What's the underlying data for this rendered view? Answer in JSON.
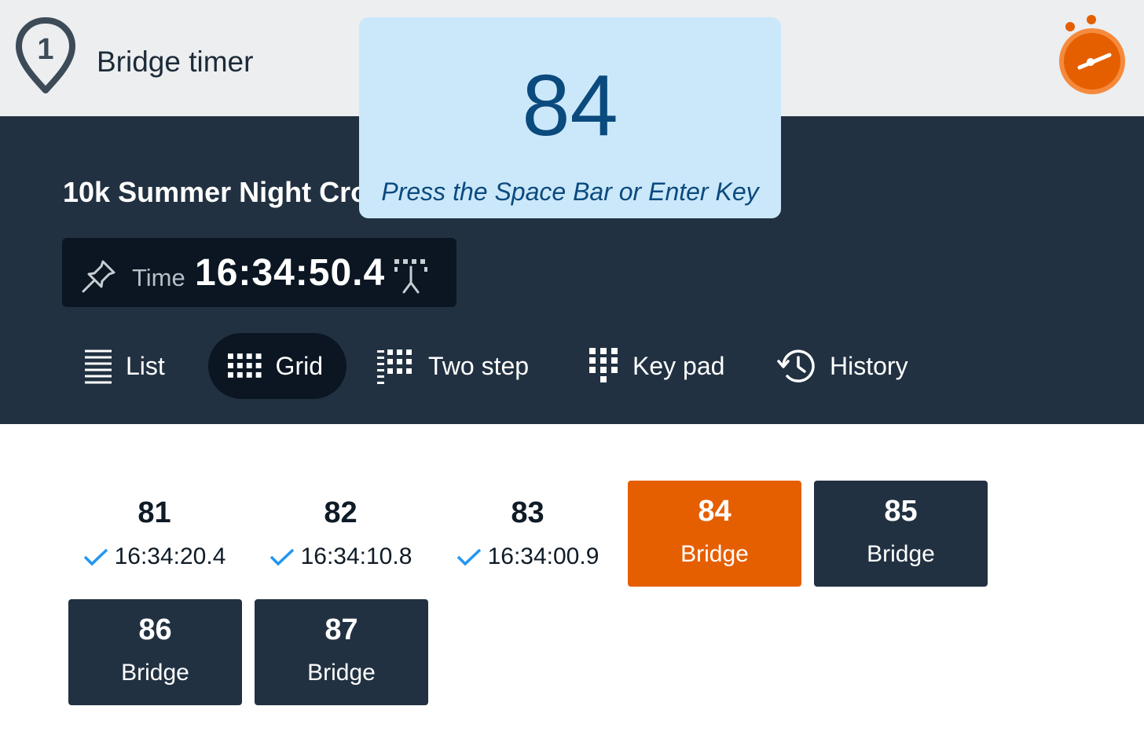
{
  "app": {
    "logo_number": "1",
    "title": "Bridge timer",
    "stopwatch_icon": "stopwatch-icon",
    "accent_color": "#e55f00"
  },
  "event": {
    "title": "10k Summer Night Cro",
    "time_label": "Time",
    "time_value": "16:34:50.4"
  },
  "tabs": [
    {
      "label": "List",
      "icon": "list-icon",
      "active": false
    },
    {
      "label": "Grid",
      "icon": "grid-icon",
      "active": true
    },
    {
      "label": "Two step",
      "icon": "two-step-icon",
      "active": false
    },
    {
      "label": "Key pad",
      "icon": "keypad-icon",
      "active": false
    },
    {
      "label": "History",
      "icon": "history-icon",
      "active": false
    }
  ],
  "popup": {
    "number": "84",
    "hint": "Press the Space Bar or Enter Key"
  },
  "grid": [
    {
      "number": "81",
      "status": "timed",
      "value": "16:34:20.4"
    },
    {
      "number": "82",
      "status": "timed",
      "value": "16:34:10.8"
    },
    {
      "number": "83",
      "status": "timed",
      "value": "16:34:00.9"
    },
    {
      "number": "84",
      "status": "current",
      "value": "Bridge"
    },
    {
      "number": "85",
      "status": "pending",
      "value": "Bridge"
    },
    {
      "number": "86",
      "status": "pending",
      "value": "Bridge"
    },
    {
      "number": "87",
      "status": "pending",
      "value": "Bridge"
    }
  ]
}
